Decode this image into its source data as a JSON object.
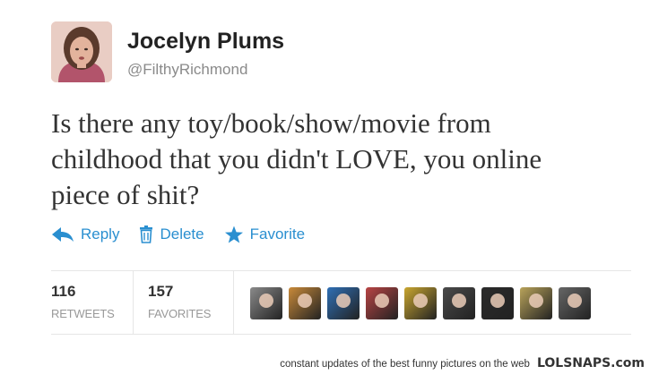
{
  "user": {
    "name": "Jocelyn Plums",
    "handle": "@FilthyRichmond"
  },
  "tweet": {
    "lines": [
      "Is there any toy/book/show/movie from",
      "childhood that you didn't LOVE, you online",
      "piece of shit?"
    ]
  },
  "actions": {
    "reply": "Reply",
    "delete": "Delete",
    "favorite": "Favorite"
  },
  "stats": {
    "retweets_count": "116",
    "retweets_label": "RETWEETS",
    "favorites_count": "157",
    "favorites_label": "FAVORITES"
  },
  "favoriters": [
    {
      "icon": "favoriter-avatar-1",
      "color": "#8a8a8a"
    },
    {
      "icon": "favoriter-avatar-2",
      "color": "#c98a3a"
    },
    {
      "icon": "favoriter-avatar-3",
      "color": "#2f6fb5"
    },
    {
      "icon": "favoriter-avatar-4",
      "color": "#b84444"
    },
    {
      "icon": "favoriter-avatar-5",
      "color": "#c9a630"
    },
    {
      "icon": "favoriter-avatar-6",
      "color": "#4a4a4a"
    },
    {
      "icon": "favoriter-avatar-7",
      "color": "#2b2b2b"
    },
    {
      "icon": "favoriter-avatar-8",
      "color": "#b9a35a"
    },
    {
      "icon": "favoriter-avatar-9",
      "color": "#666666"
    }
  ],
  "footer": {
    "tagline": "constant updates of the best funny pictures on the web",
    "brand": "LOLSNAPS.com"
  },
  "colors": {
    "link": "#2a8fd0",
    "text": "#333333",
    "muted": "#999999"
  }
}
